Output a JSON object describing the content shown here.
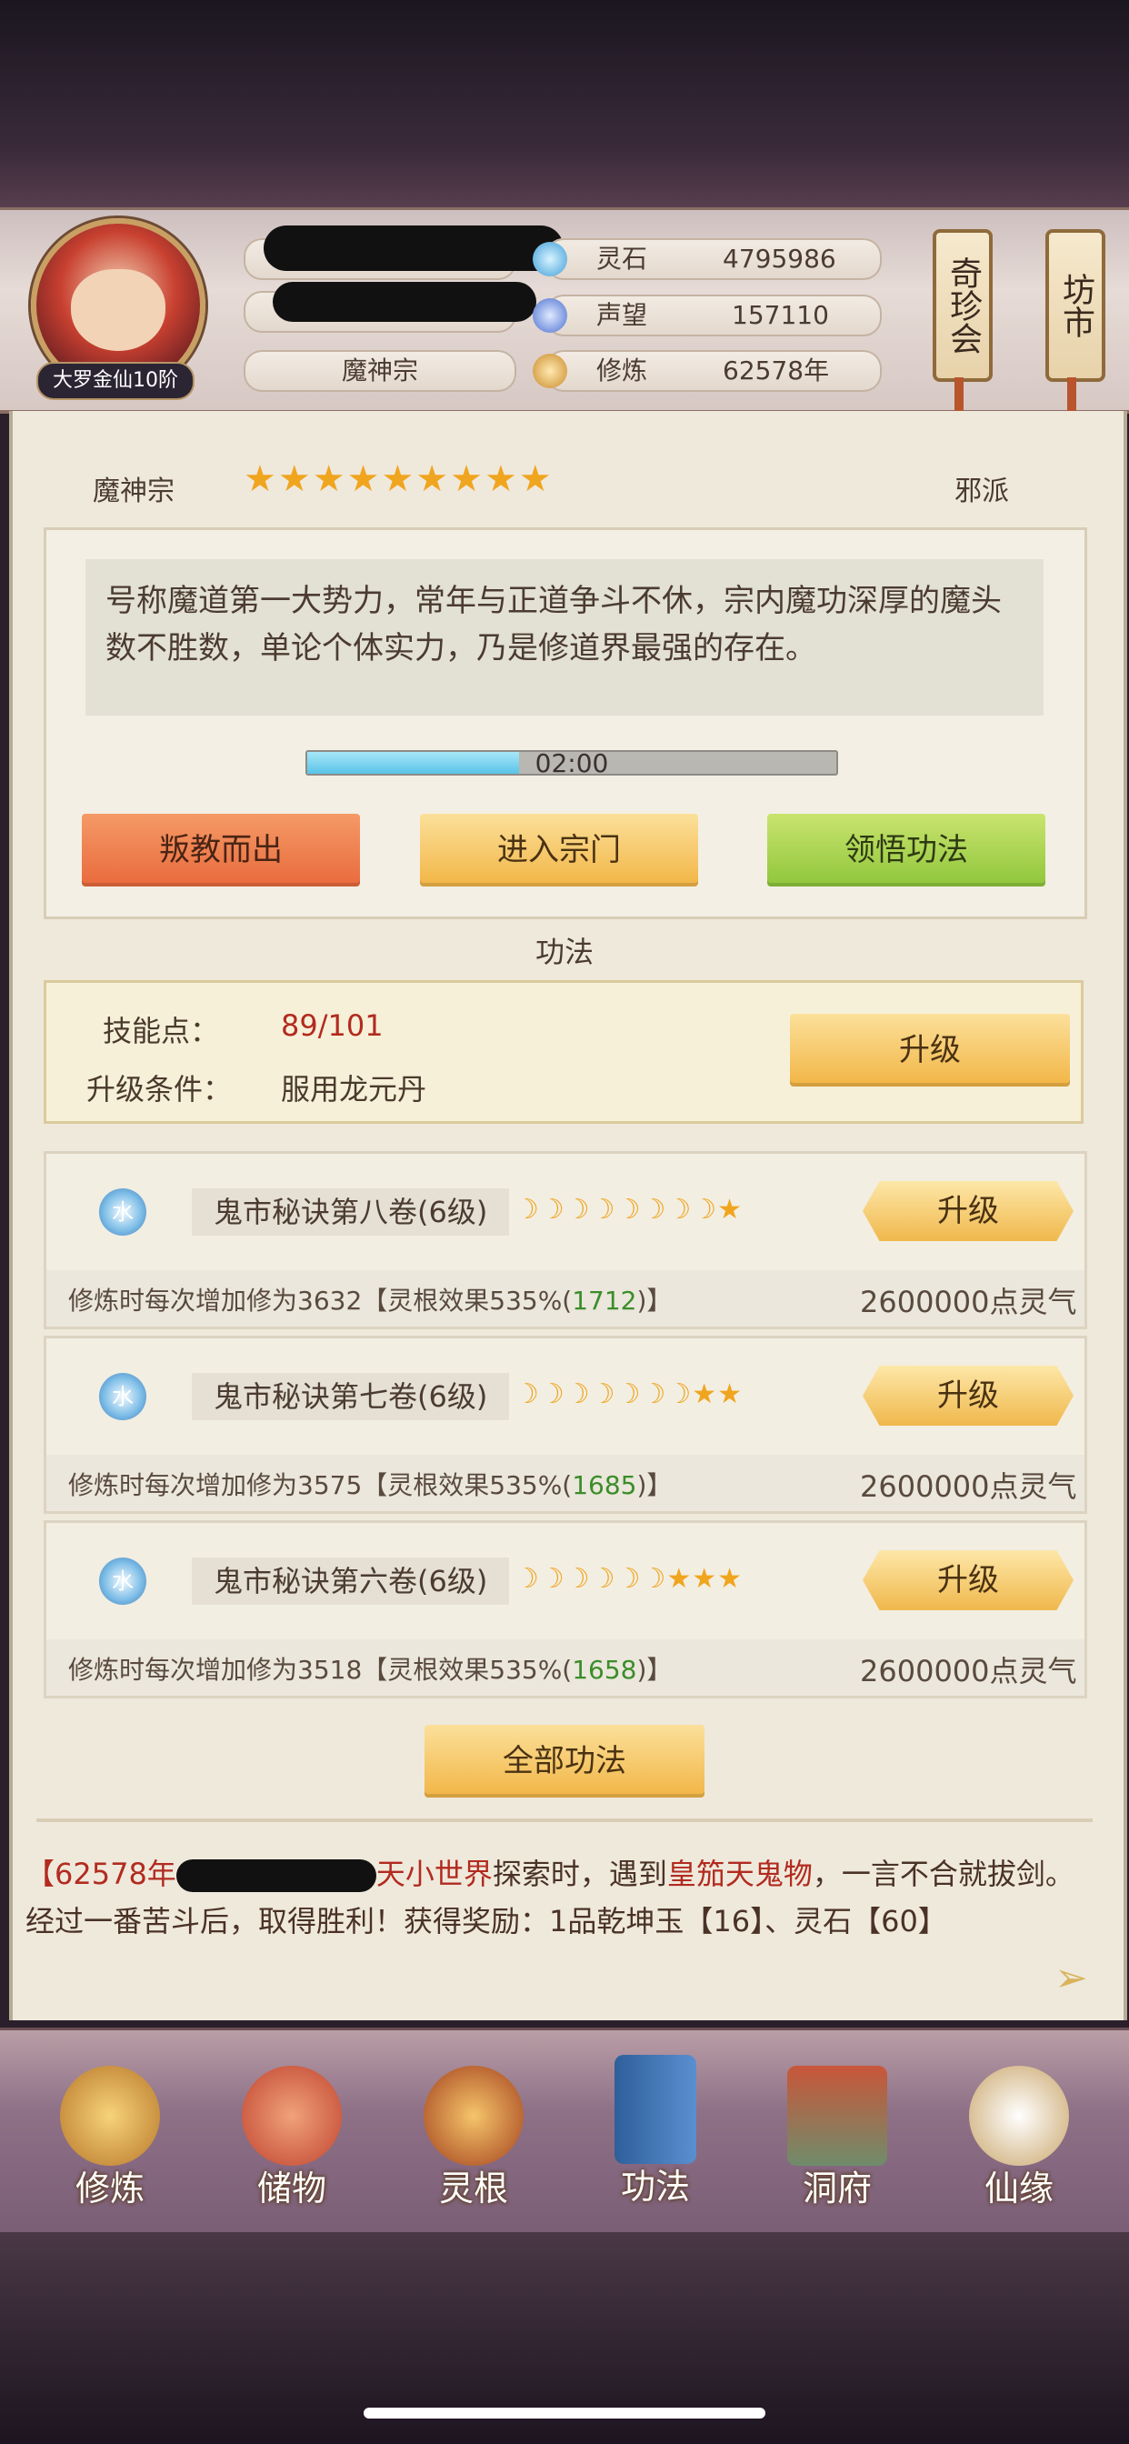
{
  "header": {
    "rank_badge": "大罗金仙10阶",
    "sect_name": "魔神宗",
    "stats": [
      {
        "icon": "spirit-stone-icon",
        "label": "灵石",
        "value": "4795986"
      },
      {
        "icon": "reputation-icon",
        "label": "声望",
        "value": "157110"
      },
      {
        "icon": "cultivation-icon",
        "label": "修炼",
        "value": "62578年"
      }
    ],
    "shop_buttons": [
      "奇珍会",
      "坊市"
    ]
  },
  "sect": {
    "name": "魔神宗",
    "stars": "★★★★★★★★★",
    "alignment": "邪派",
    "description": "号称魔道第一大势力，常年与正道争斗不休，宗内魔功深厚的魔头数不胜数，单论个体实力，乃是修道界最强的存在。",
    "timer_text": "02:00",
    "timer_progress": 0.4,
    "buttons": [
      "叛教而出",
      "进入宗门",
      "领悟功法"
    ]
  },
  "gongfa": {
    "title": "功法",
    "skill_points_label": "技能点：",
    "skill_points_value": "89/101",
    "upgrade_condition_label": "升级条件：",
    "upgrade_condition_value": "服用龙元丹",
    "upgrade_button": "升级",
    "items": [
      {
        "element": "水",
        "name": "鬼市秘诀第八卷(6级)",
        "rank": "☽☽☽☽☽☽☽☽★",
        "desc_prefix": "修炼时每次增加修为3632【灵根效果535%(",
        "desc_green": "1712",
        "desc_suffix": ")】",
        "cost": "2600000点灵气",
        "button": "升级"
      },
      {
        "element": "水",
        "name": "鬼市秘诀第七卷(6级)",
        "rank": "☽☽☽☽☽☽☽★★",
        "desc_prefix": "修炼时每次增加修为3575【灵根效果535%(",
        "desc_green": "1685",
        "desc_suffix": ")】",
        "cost": "2600000点灵气",
        "button": "升级"
      },
      {
        "element": "水",
        "name": "鬼市秘诀第六卷(6级)",
        "rank": "☽☽☽☽☽☽★★★",
        "desc_prefix": "修炼时每次增加修为3518【灵根效果535%(",
        "desc_green": "1658",
        "desc_suffix": ")】",
        "cost": "2600000点灵气",
        "button": "升级"
      }
    ],
    "all_button": "全部功法"
  },
  "log": {
    "year": "【62578年",
    "world": "天小世界",
    "t1": "探索时，遇到",
    "monster": "皇笳天鬼物",
    "t2": "，一言不合就拔剑。经过一番苦斗后，取得胜利！获得奖励：1品乾坤玉【16】、灵石【60】"
  },
  "nav": [
    "修炼",
    "储物",
    "灵根",
    "功法",
    "洞府",
    "仙缘"
  ]
}
